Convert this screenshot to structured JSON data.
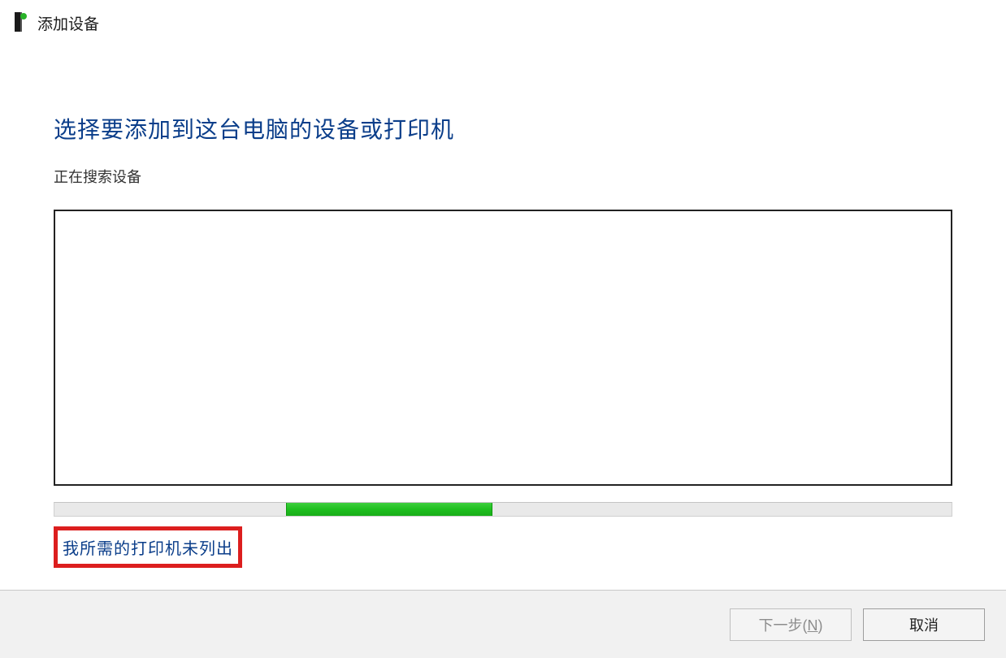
{
  "window": {
    "title": "添加设备"
  },
  "main": {
    "heading": "选择要添加到这台电脑的设备或打印机",
    "status": "正在搜索设备",
    "link": "我所需的打印机未列出"
  },
  "progress": {
    "chunk_left_pct": 25.8,
    "chunk_width_pct": 23.0
  },
  "footer": {
    "next_label_prefix": "下一步(",
    "next_key": "N",
    "next_label_suffix": ")",
    "cancel_label": "取消",
    "next_disabled": true
  },
  "colors": {
    "heading": "#0b3e8a",
    "highlight_border": "#dc1e1e",
    "progress_green": "#1fbf1f"
  }
}
